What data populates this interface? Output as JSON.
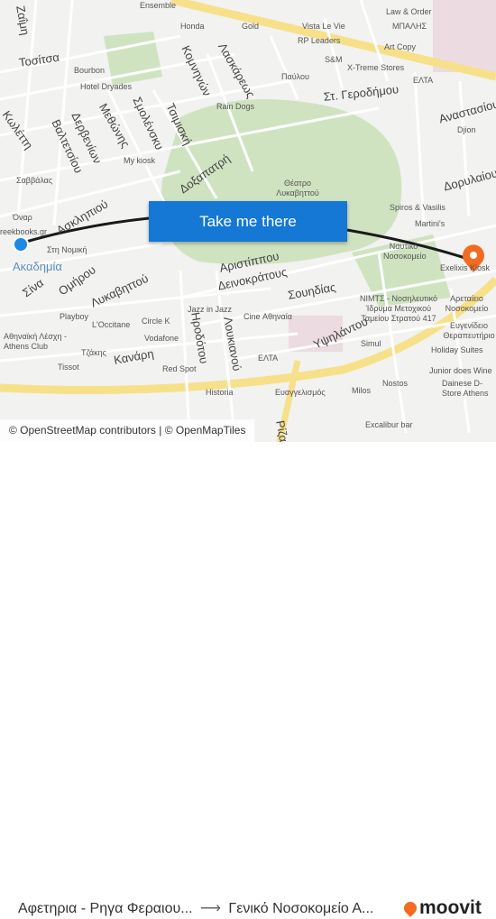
{
  "map": {
    "street_labels": [
      "Τοσίτσα",
      "Ζαΐμη",
      "Κωλέττη",
      "Βαλτετσίου",
      "Δερβενίων",
      "Μεθώνης",
      "Σμολένσκυ",
      "Τσιμισκή",
      "Κομνηνών",
      "Λασκάρεως",
      "Δοξαπατρή",
      "Ασκληπιού",
      "Σίνα",
      "Ομήρου",
      "Λυκαβηττού",
      "Κανάρη",
      "Αριστίππου",
      "Δεινοκράτους",
      "Σουηδίας",
      "Ηροδότου",
      "Λουκιανού",
      "Υψηλάντου",
      "Στ. Γεροδήμου",
      "Αναστασίου",
      "Δορυλαίου",
      "Ακαδημία",
      "Ρίζα"
    ],
    "poi_labels": [
      "Ensemble",
      "Honda",
      "Gold",
      "Vista Le Vie",
      "Law & Order",
      "ΜΠΑΛΗΣ",
      "RP Leaders",
      "Art Copy",
      "Bourbon",
      "Hotel Dryades",
      "S&M",
      "X-Treme Stores",
      "Παύλου",
      "ΕΛΤΑ",
      "Rain Dogs",
      "Djion",
      "My kiosk",
      "Θέατρο Λυκαβηττού",
      "Σαββάλας",
      "Όναρ",
      "Στη Νομική",
      "reekbooks.gr",
      "Spiros & Vasilis",
      "Martini's",
      "Ναυτικό Νοσοκομείο",
      "Exelixis Kiosk",
      "Playboy",
      "L'Occitane",
      "Circle K",
      "Vodafone",
      "Jazz in Jazz",
      "Cine Αθηναία",
      "ΝΙΜΤΣ - Νοσηλευτικό Ίδρυμα Μετοχικού Ταμείου Στρατού 417",
      "Αρεταίειο Νοσοκομείο",
      "Ευγενίδειο Θεραπευτήριο",
      "Holiday Suites",
      "Αθηναϊκή Λέσχη - Athens Club",
      "Τζάκης",
      "Tissot",
      "Red Spot",
      "ΕΛΤΑ",
      "Simul",
      "Nostos",
      "Junior does Wine",
      "Dainese D-Store Athens",
      "Historia",
      "Ευαγγελισμός",
      "Milos",
      "Excalibur bar"
    ],
    "colors": {
      "route": "#1a1a1a",
      "origin": "#1e88e5",
      "destination": "#f26b21",
      "park": "#cfe3c0",
      "highway": "#f7e08a"
    }
  },
  "cta": {
    "label": "Take me there"
  },
  "attribution": "© OpenStreetMap contributors | © OpenMapTiles",
  "footer": {
    "origin": "Αφετηρια - Ρηγα Φεραιου...",
    "arrow": "⟶",
    "destination": "Γενικό Νοσοκομείο Α...",
    "brand": "moovit"
  }
}
